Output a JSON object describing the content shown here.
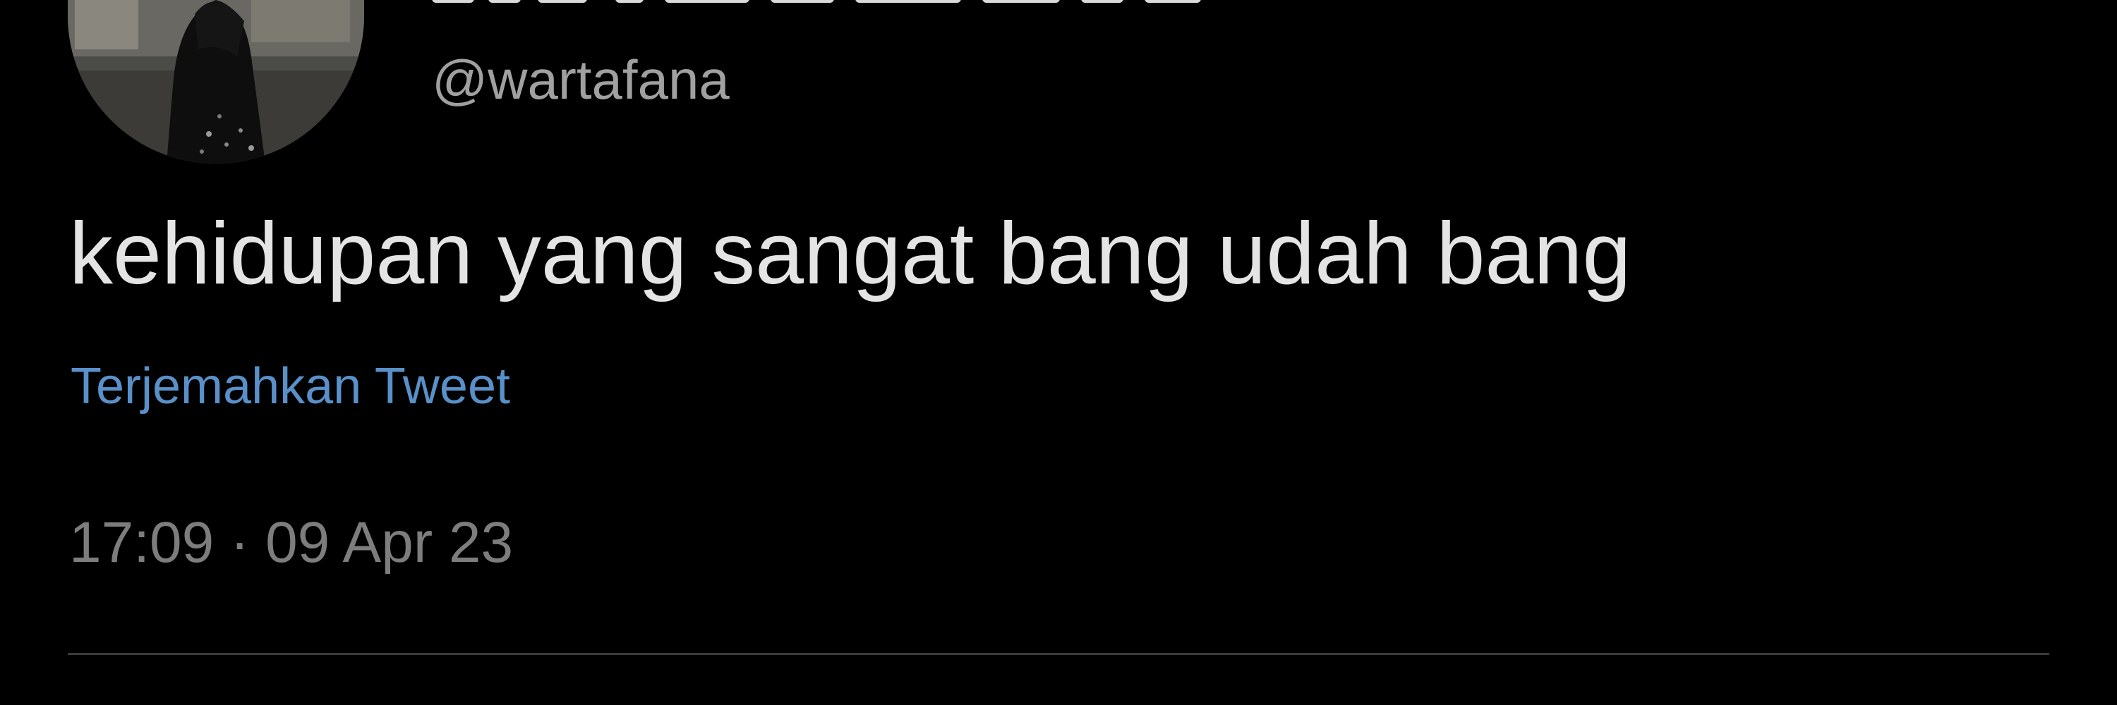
{
  "tweet": {
    "handle": "@wartafana",
    "text": "kehidupan yang sangat bang udah bang",
    "translate_label": "Terjemahkan Tweet",
    "timestamp": "17:09 · 09 Apr 23"
  },
  "colors": {
    "background": "#000000",
    "text": "#e4e4e4",
    "muted": "#7d7d7d",
    "link": "#5a90c9",
    "divider": "#3a3a3a"
  },
  "icons": {
    "avatar": "profile-photo"
  }
}
